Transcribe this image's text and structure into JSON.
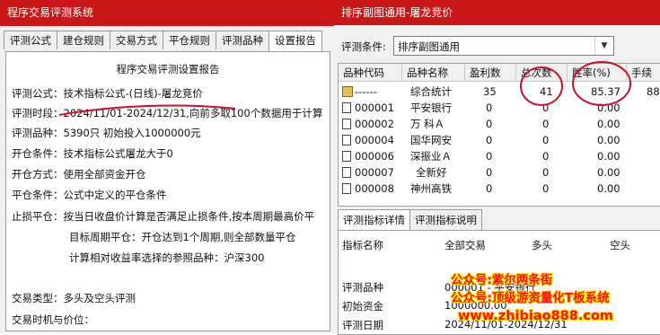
{
  "left": {
    "title": "程序交易评测系统",
    "tabs": [
      "评测公式",
      "建仓规则",
      "交易方式",
      "平仓规则",
      "评测品种",
      "设置报告"
    ],
    "report": {
      "title": "程序交易评测设置报告",
      "lines": [
        "评测公式：技术指标公式-(日线)-屠龙竞价",
        "评测时段：2024/11/01-2024/12/31,向前多取100个数据用于计算",
        "评测品种：5390只  初始投入1000000元",
        "开仓条件：技术指标公式屠龙大于0",
        "开仓方式：使用全部资金开仓",
        "平仓条件：公式中定义的平仓条件",
        "止损平仓：按当日收盘价计算是否满足止损条件,按本周期最高价平",
        "目标周期平仓：开仓达到1个周期,则全部数量平仓",
        "计算相对收益率选择的参照品种：沪深300",
        "交易类型：多头及空头评测",
        "交易时机与价位："
      ]
    }
  },
  "right": {
    "title": "排序副图通用-屠龙竞价",
    "condition_label": "评测条件:",
    "condition_value": "排序副图通用",
    "columns": [
      "品种代码",
      "品种名称",
      "盈利数",
      "总次数",
      "胜率(%)",
      "手续"
    ],
    "rows": [
      {
        "code": "------",
        "name": "综合统计",
        "profit": "35",
        "total": "41",
        "win": "85.37",
        "fee": "88",
        "icon": "summary-icon"
      },
      {
        "code": "000001",
        "name": "平安银行",
        "profit": "0",
        "total": "0",
        "win": "0.00",
        "fee": "",
        "icon": "file-icon"
      },
      {
        "code": "000002",
        "name": "万 科Ａ",
        "profit": "0",
        "total": "0",
        "win": "0.00",
        "fee": "",
        "icon": "file-icon"
      },
      {
        "code": "000004",
        "name": "国华网安",
        "profit": "0",
        "total": "0",
        "win": "0.00",
        "fee": "",
        "icon": "file-icon"
      },
      {
        "code": "000006",
        "name": "深振业Ａ",
        "profit": "0",
        "total": "0",
        "win": "0.00",
        "fee": "",
        "icon": "file-icon"
      },
      {
        "code": "000007",
        "name": "全新好",
        "profit": "0",
        "total": "0",
        "win": "0.00",
        "fee": "",
        "icon": "file-icon"
      },
      {
        "code": "000008",
        "name": "神州高铁",
        "profit": "0",
        "total": "0",
        "win": "0.00",
        "fee": "",
        "icon": "file-icon"
      }
    ],
    "bottom_tabs": [
      "评测指标详情",
      "评测指标说明"
    ],
    "detail_headers": [
      "指标名称",
      "全部交易",
      "多头",
      "空头"
    ],
    "detail_rows": [
      {
        "label": "评测品种",
        "value": "000001 - 平安银行"
      },
      {
        "label": "初始资金",
        "value": "1000000.00"
      },
      {
        "label": "评测日期",
        "value": "2024/11/01-2024/12/31"
      }
    ]
  },
  "watermark": {
    "line1": "公众号:紫尔两条街",
    "line2": "公众号:顶级游资量化T板系统",
    "line3": "www.zhibiao888.com"
  },
  "colors": {
    "titlebar": "#c91616",
    "annotation": "#c8102e",
    "watermark_text": "#ff1010",
    "watermark_outline": "#ffe600"
  }
}
